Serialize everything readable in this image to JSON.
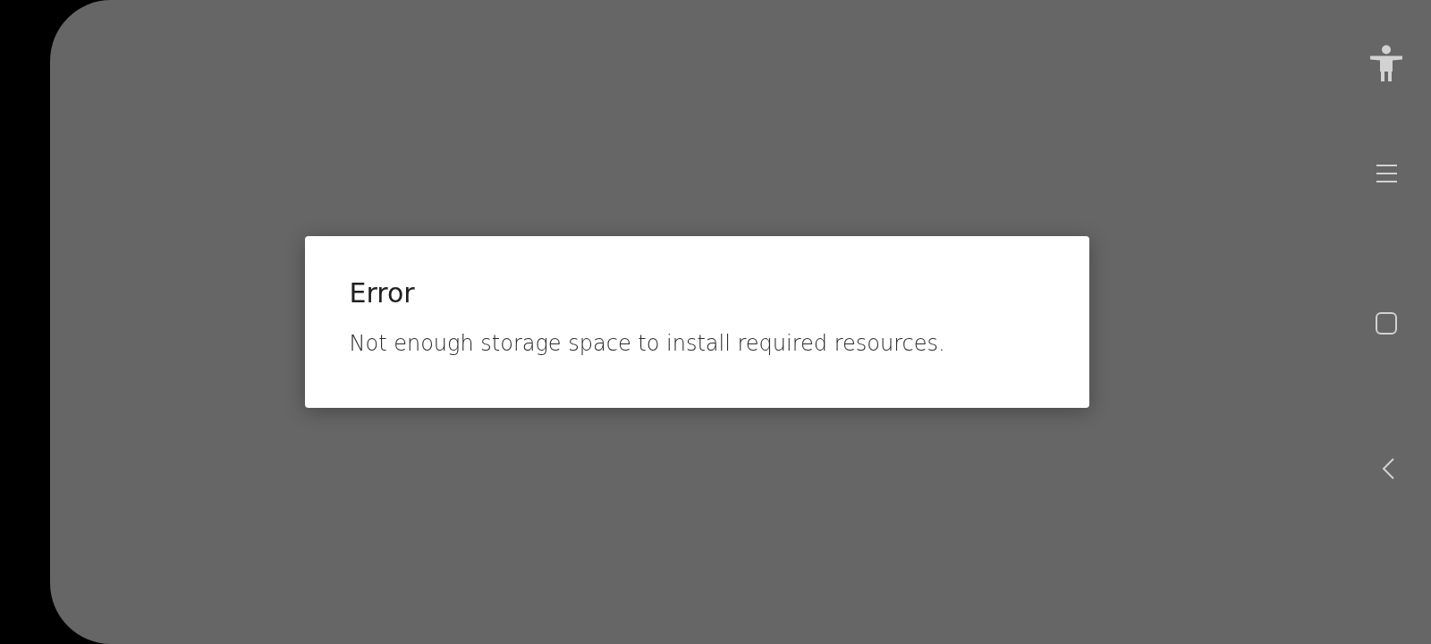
{
  "dialog": {
    "title": "Error",
    "message": "Not enough storage space to install required resources."
  }
}
